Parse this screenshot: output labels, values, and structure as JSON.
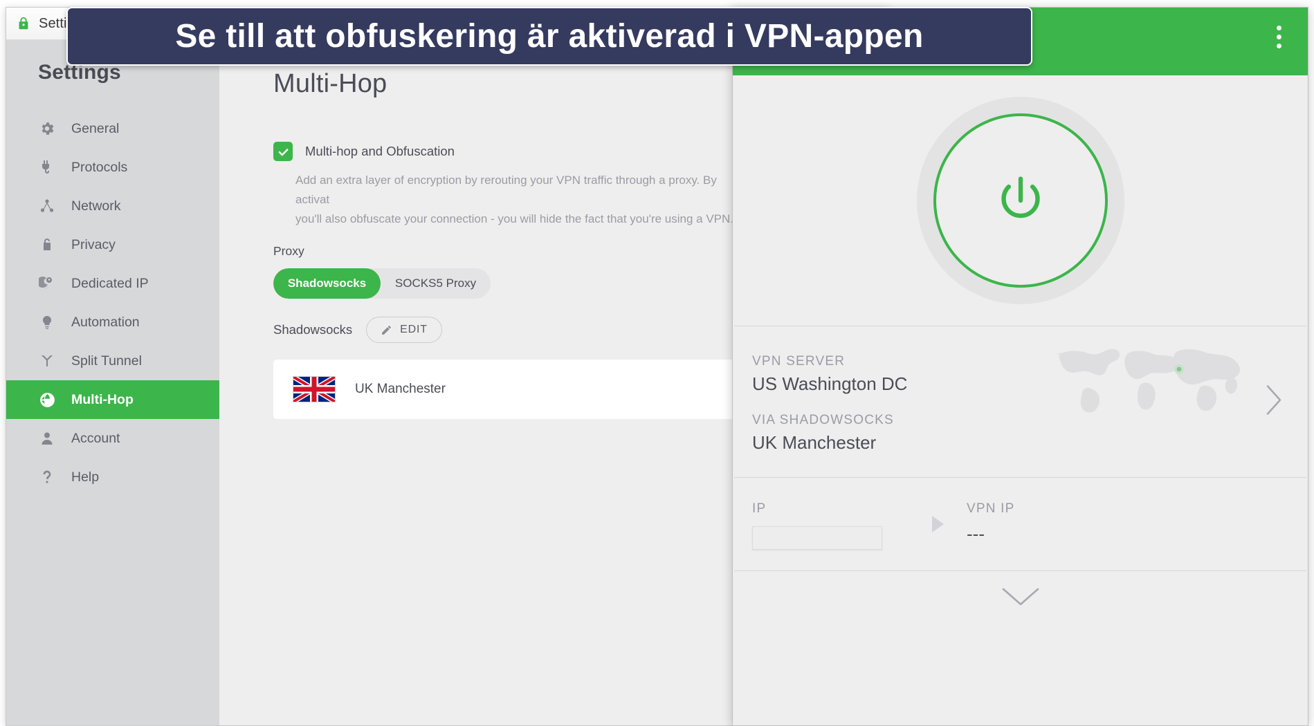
{
  "banner": {
    "text": "Se till att obfuskering är aktiverad i VPN-appen",
    "bg_color": "#353a5f",
    "text_color": "#ffffff"
  },
  "settings_window": {
    "titlebar": {
      "title": "Settings",
      "icon": "lock-icon"
    },
    "sidebar": {
      "heading": "Settings",
      "items": [
        {
          "label": "General",
          "icon": "gear-icon",
          "active": false
        },
        {
          "label": "Protocols",
          "icon": "plug-icon",
          "active": false
        },
        {
          "label": "Network",
          "icon": "network-icon",
          "active": false
        },
        {
          "label": "Privacy",
          "icon": "lock-icon",
          "active": false
        },
        {
          "label": "Dedicated IP",
          "icon": "globe-pin-icon",
          "active": false
        },
        {
          "label": "Automation",
          "icon": "lightbulb-icon",
          "active": false
        },
        {
          "label": "Split Tunnel",
          "icon": "split-tunnel-icon",
          "active": false
        },
        {
          "label": "Multi-Hop",
          "icon": "multi-hop-globe-icon",
          "active": true
        },
        {
          "label": "Account",
          "icon": "person-icon",
          "active": false
        },
        {
          "label": "Help",
          "icon": "question-mark-icon",
          "active": false
        }
      ],
      "active_color": "#3cb54a"
    },
    "main": {
      "page_title": "Multi-Hop",
      "toggle": {
        "label": "Multi-hop and Obfuscation",
        "checked": true,
        "checked_color": "#3cb54a"
      },
      "description_line1": "Add an extra layer of encryption by rerouting your VPN traffic through a proxy. By activat",
      "description_line2": "you'll also obfuscate your connection - you will hide the fact that you're using a VPN.",
      "proxy_label": "Proxy",
      "proxy_tabs": [
        {
          "label": "Shadowsocks",
          "selected": true
        },
        {
          "label": "SOCKS5 Proxy",
          "selected": false
        }
      ],
      "shadowsocks_row": {
        "label": "Shadowsocks",
        "edit_button": "EDIT"
      },
      "server_card": {
        "flag": "uk-flag-icon",
        "name": "UK Manchester"
      }
    }
  },
  "vpn_window": {
    "header_color": "#3cb54a",
    "menu_icon": "kebab-menu-icon",
    "power_button": {
      "icon": "power-icon",
      "ring_color": "#3cb54a"
    },
    "server_section": {
      "vpn_server_label": "VPN SERVER",
      "vpn_server_value": "US Washington DC",
      "via_label": "VIA SHADOWSOCKS",
      "via_value": "UK Manchester",
      "chevron": "chevron-right-icon",
      "map": "world-map-icon"
    },
    "ip_section": {
      "ip_label": "IP",
      "ip_value": "",
      "arrow": "triangle-right-icon",
      "vpn_ip_label": "VPN IP",
      "vpn_ip_value": "---"
    },
    "expand_icon": "chevron-down-icon"
  }
}
